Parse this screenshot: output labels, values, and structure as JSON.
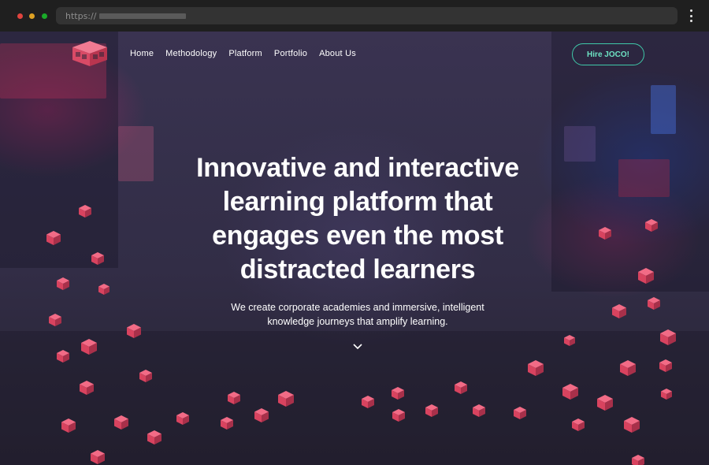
{
  "browser": {
    "url_prefix": "https://",
    "icons": [
      "close-dot",
      "minimize-dot",
      "maximize-dot",
      "kebab-menu-icon"
    ]
  },
  "nav": {
    "logo_icon": "joco-cube-logo",
    "items": [
      {
        "label": "Home"
      },
      {
        "label": "Methodology"
      },
      {
        "label": "Platform"
      },
      {
        "label": "Portfolio"
      },
      {
        "label": "About Us"
      }
    ],
    "cta_label": "Hire JOCO!"
  },
  "hero": {
    "headline_lines": [
      "Innovative and interactive",
      "learning platform that",
      "engages even the most",
      "distracted learners"
    ],
    "sub_lines": [
      "We create corporate academies and immersive, intelligent",
      "knowledge journeys that amplify learning."
    ],
    "scroll_icon": "chevron-down-icon"
  },
  "colors": {
    "cube_top": "#f26b86",
    "cube_left": "#d8435f",
    "cube_right": "#a8304a",
    "cta_border": "#3fc8a8",
    "cta_text": "#6ee4c4"
  }
}
